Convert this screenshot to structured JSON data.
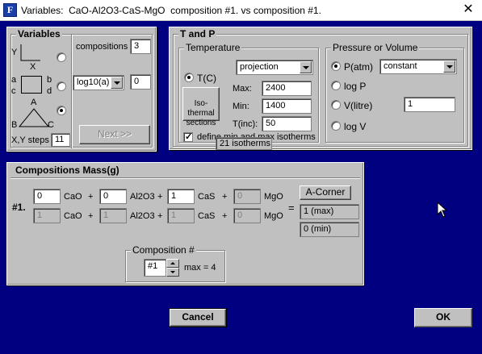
{
  "window": {
    "title": "Variables:  CaO-Al2O3-CaS-MgO  composition #1. vs composition #1.",
    "close_glyph": "✕"
  },
  "variables": {
    "title": "Variables",
    "y_label": "Y",
    "x_label": "X",
    "corner_a": "a",
    "corner_b": "b",
    "corner_c": "c",
    "corner_d": "d",
    "tri_a": "A",
    "tri_b": "B",
    "tri_c": "C",
    "xy_steps_label": "X,Y steps",
    "xy_steps_value": "11",
    "compositions_label": "compositions",
    "compositions_value": "3",
    "scale_select": "log10(a)",
    "scale_value": "0",
    "next_label": "Next >>",
    "selected_mode": "triangle"
  },
  "t_and_p": {
    "title": "T and P",
    "temperature": {
      "title": "Temperature",
      "t_label": "T(C)",
      "mode_select": "projection",
      "iso_label": "Iso-\nthermal\nsections",
      "max_label": "Max:",
      "max_value": "2400",
      "min_label": "Min:",
      "min_value": "1400",
      "inc_label": "T(inc):",
      "inc_value": "50",
      "define_label": "define min and max isotherms",
      "define_checked": true,
      "isotherms_label": "21 isotherms"
    },
    "pressure": {
      "title": "Pressure or Volume",
      "patm_label": "P(atm)",
      "mode_select": "constant",
      "logp_label": "log P",
      "vlitre_label": "V(litre)",
      "value": "1",
      "logv_label": "log V",
      "selected": "P(atm)"
    }
  },
  "compositions_mass": {
    "title": "Compositions Mass(g)",
    "row_label": "#1.",
    "plus": "+",
    "equals": "=",
    "row1": [
      {
        "value": "0",
        "unit": "CaO"
      },
      {
        "value": "0",
        "unit": "Al2O3"
      },
      {
        "value": "1",
        "unit": "CaS"
      },
      {
        "value": "0",
        "unit": "MgO"
      }
    ],
    "row2": [
      {
        "value": "1",
        "unit": "CaO"
      },
      {
        "value": "1",
        "unit": "Al2O3"
      },
      {
        "value": "1",
        "unit": "CaS"
      },
      {
        "value": "0",
        "unit": "MgO"
      }
    ],
    "corner_button": "A-Corner",
    "max_value": "1 (max)",
    "min_value": "0 (min)",
    "composition_group": {
      "title": "Composition #",
      "value": "#1",
      "max_label": "max = 4"
    }
  },
  "buttons": {
    "cancel": "Cancel",
    "ok": "OK"
  }
}
